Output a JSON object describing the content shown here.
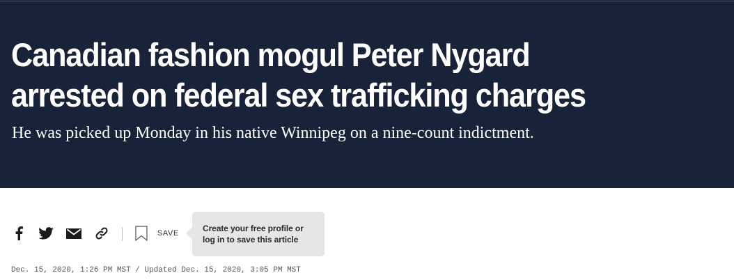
{
  "article": {
    "headline_line1": "Canadian fashion mogul Peter Nygard",
    "headline_line2": "arrested on federal sex trafficking charges",
    "dek": "He was picked up Monday in his native Winnipeg on a nine-count indictment.",
    "timestamp": "Dec. 15, 2020, 1:26 PM MST / Updated Dec. 15, 2020, 3:05 PM MST"
  },
  "share": {
    "icons": [
      "facebook-icon",
      "twitter-icon",
      "email-icon",
      "link-icon",
      "bookmark-icon"
    ],
    "save_label": "SAVE"
  },
  "tooltip": {
    "line1": "Create your free profile or",
    "line2": "log in to save this article"
  },
  "colors": {
    "hero_background": "#182238",
    "icon": "#1a1a1a",
    "tooltip_background": "#e6e6e6"
  }
}
